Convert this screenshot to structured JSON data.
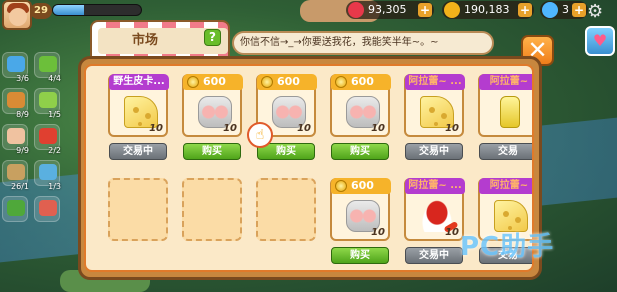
{
  "top_bar": {
    "level": "29",
    "xp_fraction": 0.35,
    "resources": [
      {
        "name": "hearts",
        "value": "93,305",
        "icon": "heart-icon",
        "color": "#e8384a"
      },
      {
        "name": "coins",
        "value": "190,183",
        "icon": "coin-icon",
        "color": "#f2b21a"
      },
      {
        "name": "gems",
        "value": "3",
        "icon": "gem-icon",
        "color": "#4fb6ff"
      }
    ],
    "plus_label": "+"
  },
  "side_items": [
    {
      "icon": "water-drop-icon",
      "count": "3/6",
      "color": "#4aa8e8"
    },
    {
      "icon": "leaf-icon",
      "count": "4/4",
      "color": "#6cbf3a"
    },
    {
      "icon": "bread-icon",
      "count": "8/9",
      "color": "#d98b35"
    },
    {
      "icon": "vegetable-icon",
      "count": "1/5",
      "color": "#8fcf4a"
    },
    {
      "icon": "cake-icon",
      "count": "9/9",
      "color": "#f0c2a0"
    },
    {
      "icon": "tomato-icon",
      "count": "2/2",
      "color": "#e04030"
    },
    {
      "icon": "sack-icon",
      "count": "26/1",
      "color": "#c8a060"
    },
    {
      "icon": "box-icon",
      "count": "1/3",
      "color": "#5ab0e0"
    },
    {
      "icon": "salad-icon",
      "count": "",
      "color": "#4fa83a"
    },
    {
      "icon": "doll-icon",
      "count": "",
      "color": "#e06050"
    }
  ],
  "market": {
    "title": "市场",
    "help_label": "?",
    "speech": "你信不信→_→你要送我花，我能笑半年~。~",
    "close_label": "✕"
  },
  "slots": [
    {
      "state": "listing",
      "tag_type": "name",
      "tag": "野生皮卡...",
      "good": "cheese",
      "qty": "10",
      "button": {
        "type": "trade",
        "label": "交易中"
      }
    },
    {
      "state": "listing",
      "tag_type": "price",
      "tag": "600",
      "good": "fish",
      "qty": "10",
      "button": {
        "type": "buy",
        "label": "购买"
      }
    },
    {
      "state": "listing",
      "tag_type": "price",
      "tag": "600",
      "good": "fish",
      "qty": "10",
      "button": {
        "type": "buy",
        "label": "购买"
      }
    },
    {
      "state": "listing",
      "tag_type": "price",
      "tag": "600",
      "good": "fish",
      "qty": "10",
      "button": {
        "type": "buy",
        "label": "购买"
      }
    },
    {
      "state": "listing",
      "tag_type": "name",
      "tag": "阿拉蕾~ ...",
      "good": "cheese",
      "qty": "10",
      "button": {
        "type": "trade",
        "label": "交易中"
      }
    },
    {
      "state": "listing",
      "tag_type": "name",
      "tag": "阿拉蕾~",
      "good": "oil",
      "qty": "",
      "button": {
        "type": "trade",
        "label": "交易"
      }
    },
    {
      "state": "empty"
    },
    {
      "state": "empty"
    },
    {
      "state": "empty"
    },
    {
      "state": "listing",
      "tag_type": "price",
      "tag": "600",
      "good": "fish",
      "qty": "10",
      "button": {
        "type": "buy",
        "label": "购买"
      }
    },
    {
      "state": "listing",
      "tag_type": "name",
      "tag": "阿拉蕾~ ...",
      "good": "chili",
      "qty": "10",
      "button": {
        "type": "trade",
        "label": "交易中"
      }
    },
    {
      "state": "listing",
      "tag_type": "name",
      "tag": "阿拉蕾~",
      "good": "cheese",
      "qty": "",
      "button": {
        "type": "trade",
        "label": "交易"
      }
    }
  ],
  "watermark": "PC助手"
}
